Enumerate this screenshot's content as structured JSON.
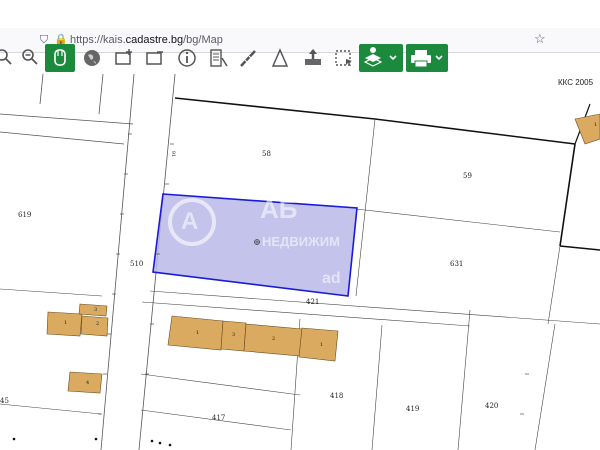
{
  "browser": {
    "url_prefix": "https://kais.",
    "url_domain": "cadastre.bg",
    "url_path": "/bg/Map",
    "icons": [
      "shield-icon",
      "lock-icon",
      "bookmark-star-icon"
    ]
  },
  "toolbar": {
    "tools": [
      "magnify-icon",
      "zoom-out-icon",
      "pan-hand-icon",
      "globe-icon",
      "add-shape-icon",
      "remove-shape-icon",
      "info-icon",
      "attributes-icon",
      "measure-distance-icon",
      "measure-area-icon",
      "upload-icon",
      "select-area-icon"
    ],
    "layers_button": "layers-icon",
    "print_button": "printer-icon"
  },
  "map": {
    "colors": {
      "parcel_selected_fill": "#b9b9e8",
      "parcel_selected_stroke": "#1a1ad9",
      "building_fill": "#d9aa5f",
      "parcel_stroke": "#000000"
    },
    "kks_label": "ККС 2005",
    "watermark": {
      "logo": "A",
      "text_main": "АБ",
      "text_sub": "НЕДВИЖИМ",
      "text_sub2": "ad"
    },
    "parcels": [
      "58",
      "59",
      "619",
      "510",
      "631",
      "421",
      "417",
      "418",
      "419",
      "420",
      "45",
      "91"
    ],
    "buildings": [
      "1",
      "2",
      "3",
      "1",
      "3",
      "2",
      "1",
      "1",
      "4"
    ]
  }
}
